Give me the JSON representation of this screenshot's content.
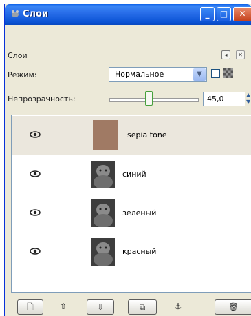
{
  "window": {
    "title": "Слои"
  },
  "panel": {
    "label": "Слои",
    "mode_label": "Режим:",
    "mode_value": "Нормальное",
    "opacity_label": "Непрозрачность:",
    "opacity_value": "45,0",
    "opacity_level": 0.45
  },
  "layers": [
    {
      "name": "sepia tone",
      "selected": true,
      "thumb_color": "#a07a64"
    },
    {
      "name": "синий"
    },
    {
      "name": "зеленый"
    },
    {
      "name": "красный"
    }
  ],
  "icons": {
    "window": "gimp-icon",
    "visibility": "eye-icon",
    "bottom": [
      "new-layer-icon",
      "raise-layer-icon",
      "lower-layer-icon",
      "duplicate-layer-icon",
      "anchor-layer-icon",
      "delete-layer-icon"
    ]
  },
  "colors": {
    "titlebar": "#0a52d4",
    "window_bg": "#ece9d8",
    "selected_row": "#ebe7dd"
  }
}
